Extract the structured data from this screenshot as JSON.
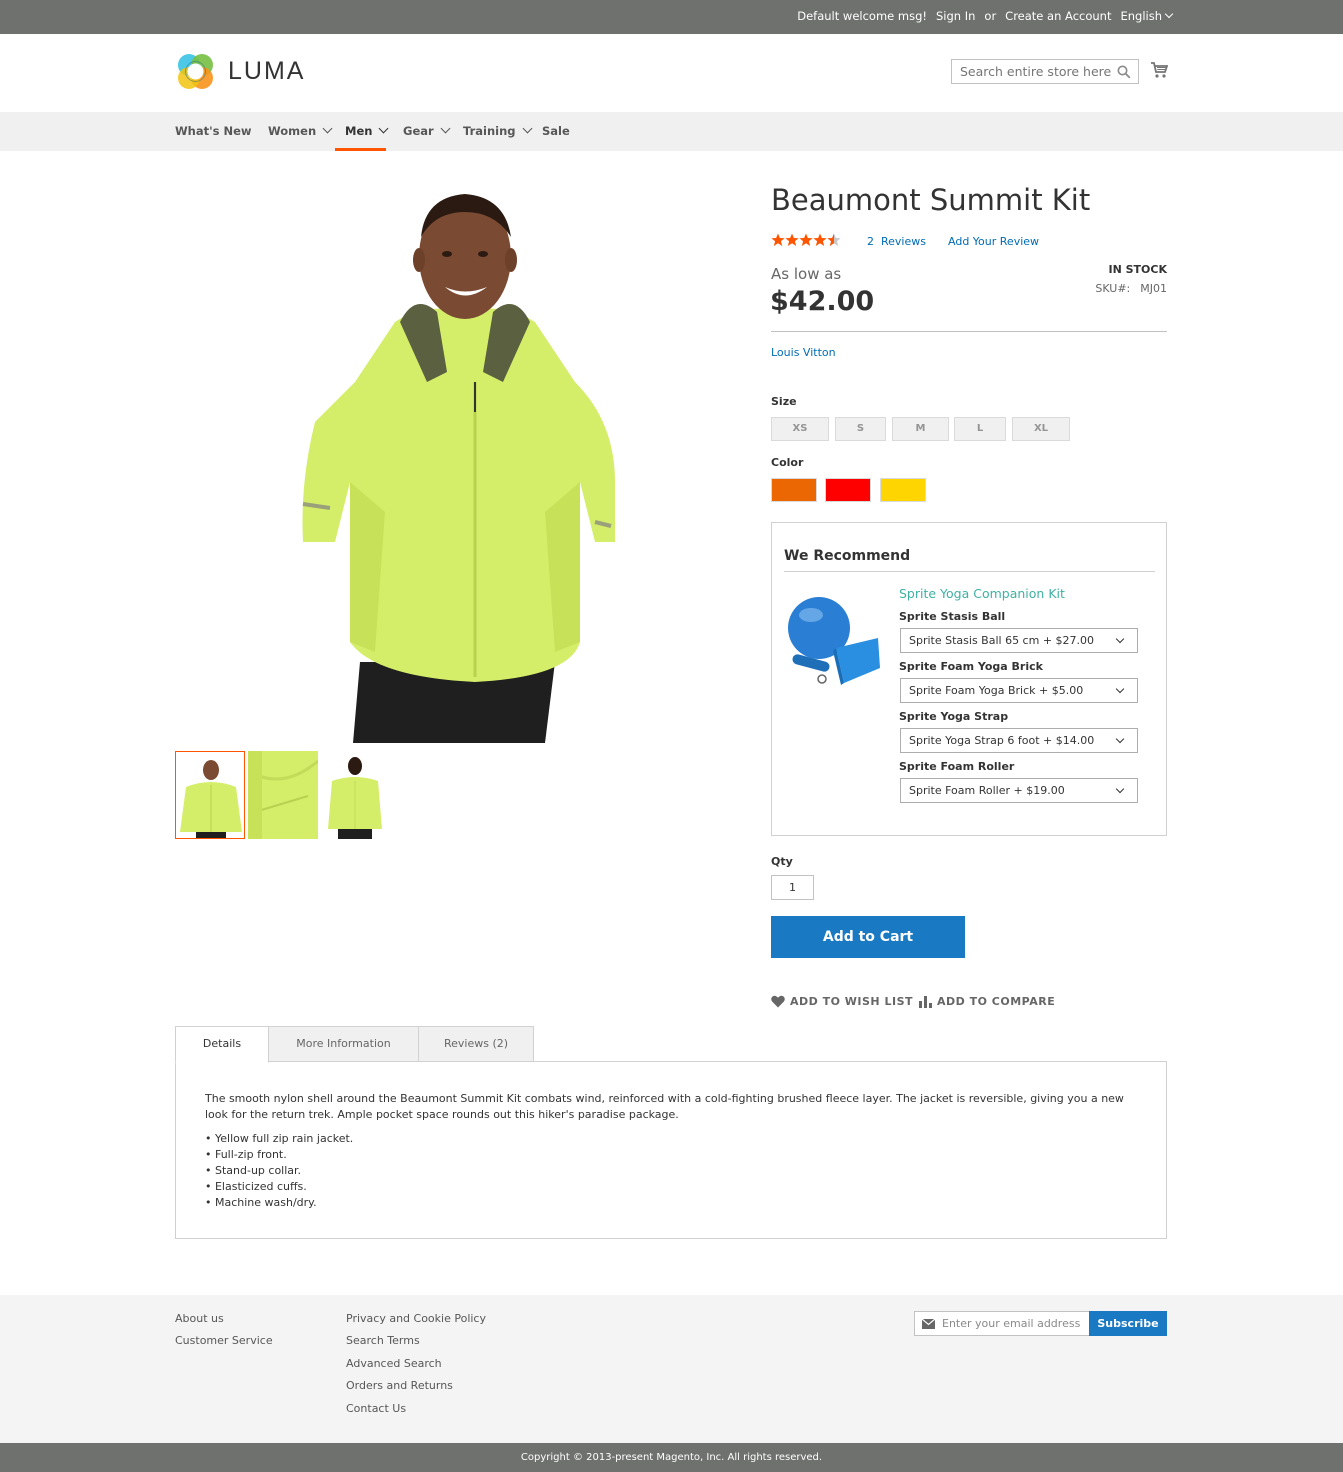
{
  "topbar": {
    "welcome": "Default welcome msg!",
    "sign_in": "Sign In",
    "or": "or",
    "create_account": "Create an Account",
    "language": "English"
  },
  "header": {
    "logo_text": "LUMA",
    "search_placeholder": "Search entire store here..",
    "search_value": ""
  },
  "nav": {
    "items": [
      {
        "label": "What's New",
        "has_dropdown": false
      },
      {
        "label": "Women",
        "has_dropdown": true
      },
      {
        "label": "Men",
        "has_dropdown": true,
        "active": true
      },
      {
        "label": "Gear",
        "has_dropdown": true
      },
      {
        "label": "Training",
        "has_dropdown": true
      },
      {
        "label": "Sale",
        "has_dropdown": false
      }
    ]
  },
  "product": {
    "title": "Beaumont Summit Kit",
    "rating_stars": 4.5,
    "reviews_count": "2",
    "reviews_label": "Reviews",
    "add_review": "Add Your Review",
    "as_low_as": "As low as",
    "price": "$42.00",
    "stock": "IN STOCK",
    "sku_label": "SKU#:",
    "sku": "MJ01",
    "brand": "Louis Vitton",
    "size_label": "Size",
    "sizes": [
      "XS",
      "S",
      "M",
      "L",
      "XL"
    ],
    "color_label": "Color",
    "colors": [
      "#eb6703",
      "#ff0000",
      "#ffd500"
    ],
    "qty_label": "Qty",
    "qty": "1",
    "add_to_cart": "Add to Cart",
    "wish_list": "ADD TO WISH LIST",
    "compare": "ADD TO COMPARE"
  },
  "recommend": {
    "title": "We Recommend",
    "kit_name": "Sprite Yoga Companion Kit",
    "options": [
      {
        "label": "Sprite Stasis Ball",
        "selected": "Sprite Stasis Ball 65 cm + $27.00"
      },
      {
        "label": "Sprite Foam Yoga Brick",
        "selected": "Sprite Foam Yoga Brick + $5.00"
      },
      {
        "label": "Sprite Yoga Strap",
        "selected": "Sprite Yoga Strap 6 foot + $14.00"
      },
      {
        "label": "Sprite Foam Roller",
        "selected": "Sprite Foam Roller + $19.00"
      }
    ]
  },
  "tabs": {
    "details": "Details",
    "more_info": "More Information",
    "reviews": "Reviews (2)"
  },
  "details": {
    "description": "The smooth nylon shell around the Beaumont Summit Kit combats wind, reinforced with a cold-fighting brushed fleece layer. The jacket is reversible, giving you a new look for the return trek. Ample pocket space rounds out this hiker's paradise package.",
    "bullets": [
      "• Yellow full zip rain jacket.",
      "• Full-zip front.",
      "• Stand-up collar.",
      "• Elasticized cuffs.",
      "• Machine wash/dry."
    ]
  },
  "footer": {
    "col1": [
      "About us",
      "Customer Service"
    ],
    "col2": [
      "Privacy and Cookie Policy",
      "Search Terms",
      "Advanced Search",
      "Orders and Returns",
      "Contact Us"
    ],
    "newsletter_placeholder": "Enter your email address",
    "subscribe": "Subscribe",
    "copyright": "Copyright © 2013-present Magento, Inc. All rights reserved."
  },
  "colors": {
    "accent_orange": "#ff5501",
    "primary_blue": "#1979c3",
    "link_blue": "#006bb4",
    "jacket_green": "#d4ee6a"
  }
}
